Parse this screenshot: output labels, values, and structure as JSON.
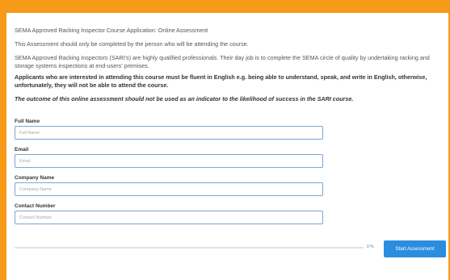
{
  "colors": {
    "frame": "#f79a17",
    "accent": "#2b8de0",
    "input_border": "#7aa6d4"
  },
  "intro": {
    "title": "SEMA Approved Racking Inspector Course Application: Online Assessment",
    "note": "This Assessment should only be completed by the person who will be attending the course.",
    "description": "SEMA Approved Racking Inspectors (SARI's) are highly qualified professionals. Their day job is to complete the SEMA circle of quality by undertaking racking and storage systems inspections at end-users' premises.",
    "requirement": "Applicants who are interested in attending this course must be fluent in English e.g. being able to understand, speak, and write in English, otherwise, unfortunately, they will not be able to attend the course.",
    "disclaimer": "The outcome of this online assessment should not be used as an indicator to the likelihood of success in the SARI course."
  },
  "form": {
    "full_name": {
      "label": "Full Name",
      "placeholder": "Full Name",
      "value": ""
    },
    "email": {
      "label": "Email",
      "placeholder": "Email",
      "value": ""
    },
    "company_name": {
      "label": "Company Name",
      "placeholder": "Company Name",
      "value": ""
    },
    "contact_number": {
      "label": "Contact Number",
      "placeholder": "Contact Number",
      "value": ""
    }
  },
  "progress": {
    "percent": 0,
    "label": "0 %"
  },
  "start_button": {
    "label": "Start Assessment"
  }
}
